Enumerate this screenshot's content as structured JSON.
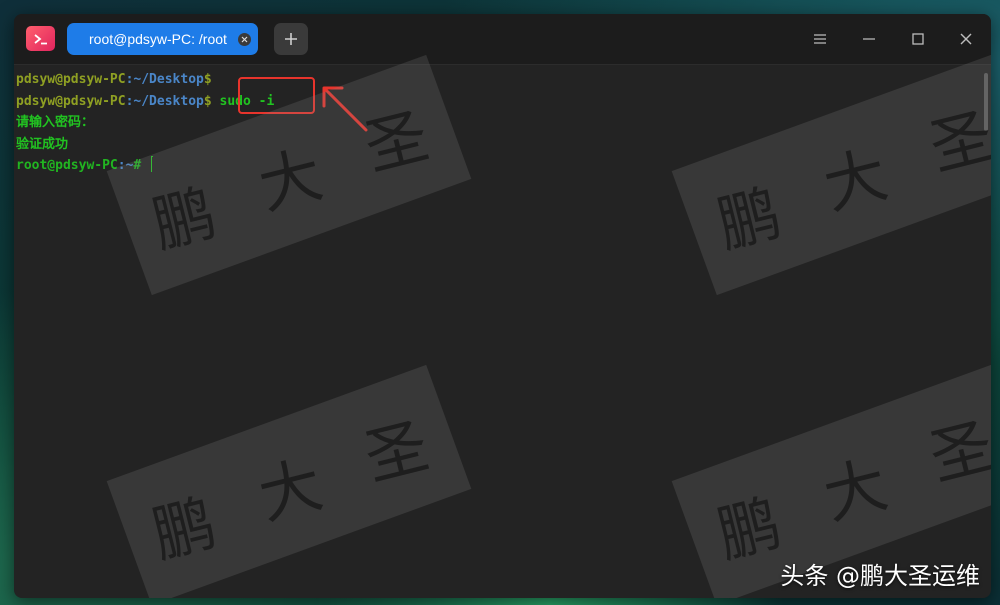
{
  "tab": {
    "title": "root@pdsyw-PC: /root"
  },
  "terminal": {
    "lines": [
      {
        "host": "pdsyw@pdsyw-PC",
        "sep": ":",
        "path": "~/Desktop",
        "prompt": "$",
        "cmd": ""
      },
      {
        "host": "pdsyw@pdsyw-PC",
        "sep": ":",
        "path": "~/Desktop",
        "prompt": "$",
        "cmd": " sudo -i"
      },
      {
        "msg": "请输入密码："
      },
      {
        "msg": "验证成功"
      },
      {
        "host": "root@pdsyw-PC",
        "sep": ":",
        "path": "~",
        "prompt": "#",
        "cmd": " "
      }
    ]
  },
  "watermark": {
    "chars": [
      "鹏",
      "大",
      "圣"
    ]
  },
  "footer_watermark": "头条 @鹏大圣运维",
  "icons": {
    "app": "terminal-icon",
    "tab_close": "close-icon",
    "new_tab": "plus-icon",
    "menu": "hamburger-menu-icon",
    "minimize": "minimize-icon",
    "maximize": "maximize-icon",
    "close": "close-icon",
    "annotation": "red-arrow-icon"
  },
  "colors": {
    "tab_active": "#1e7ce8",
    "user_host": "#8fa023",
    "path": "#4a86c8",
    "root_host": "#21b521",
    "command": "#21c321",
    "annotation": "#e8342c"
  }
}
